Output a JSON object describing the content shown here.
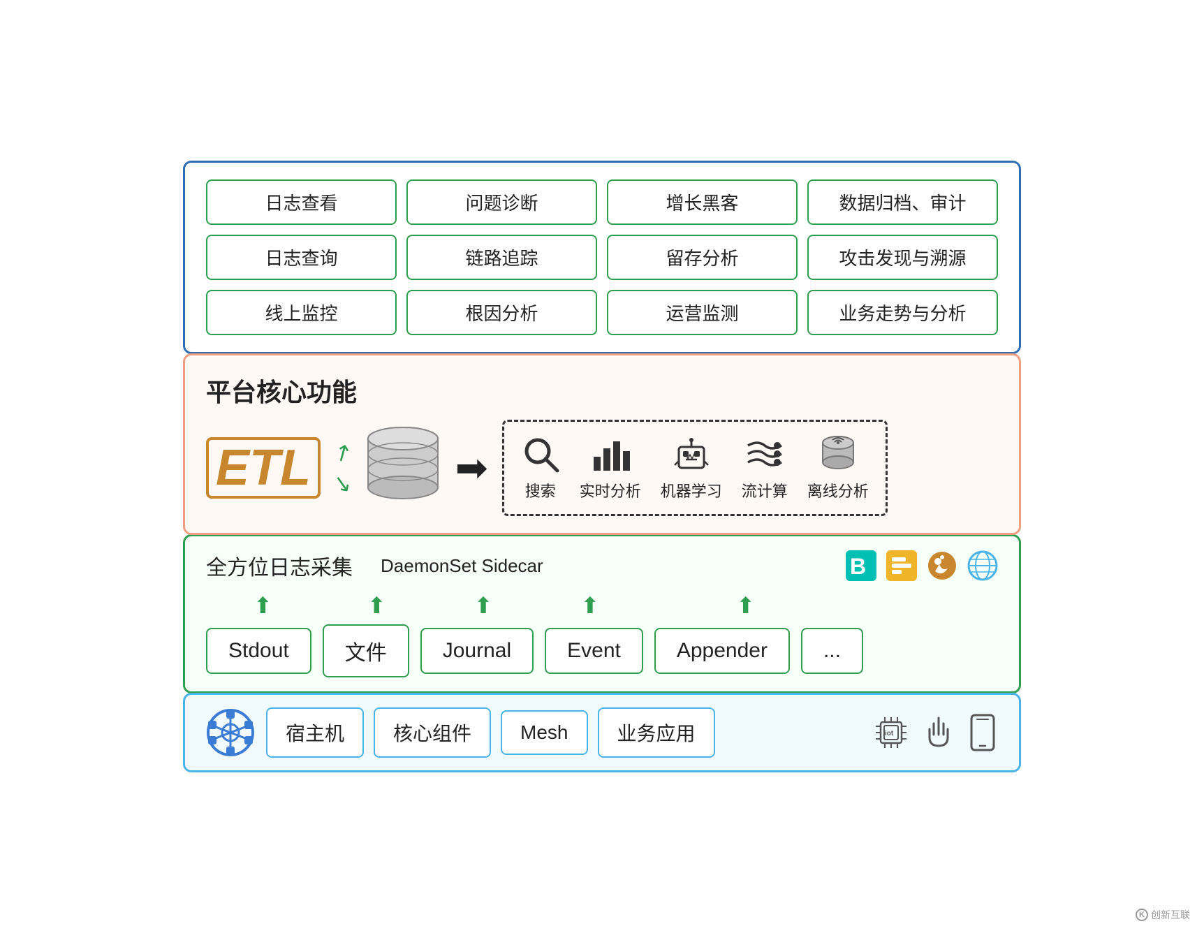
{
  "top_section": {
    "use_cases": [
      "日志查看",
      "问题诊断",
      "增长黑客",
      "数据归档、审计",
      "日志查询",
      "链路追踪",
      "留存分析",
      "攻击发现与溯源",
      "线上监控",
      "根因分析",
      "运营监测",
      "业务走势与分析"
    ]
  },
  "middle_section": {
    "title": "平台核心功能",
    "etl_label": "ETL",
    "processing_icons": [
      {
        "label": "搜索",
        "symbol": "🔍"
      },
      {
        "label": "实时分析",
        "symbol": "📊"
      },
      {
        "label": "机器学习",
        "symbol": "🤖"
      },
      {
        "label": "流计算",
        "symbol": "〜"
      },
      {
        "label": "离线分析",
        "symbol": "🗄"
      }
    ]
  },
  "log_collection": {
    "title": "全方位日志采集",
    "daemon_sidecar": "DaemonSet  Sidecar",
    "log_types": [
      "Stdout",
      "文件",
      "Journal",
      "Event",
      "Appender",
      "..."
    ]
  },
  "sources": {
    "items": [
      "宿主机",
      "核心组件",
      "Mesh",
      "业务应用"
    ]
  },
  "watermark": {
    "text": "创新互联"
  }
}
